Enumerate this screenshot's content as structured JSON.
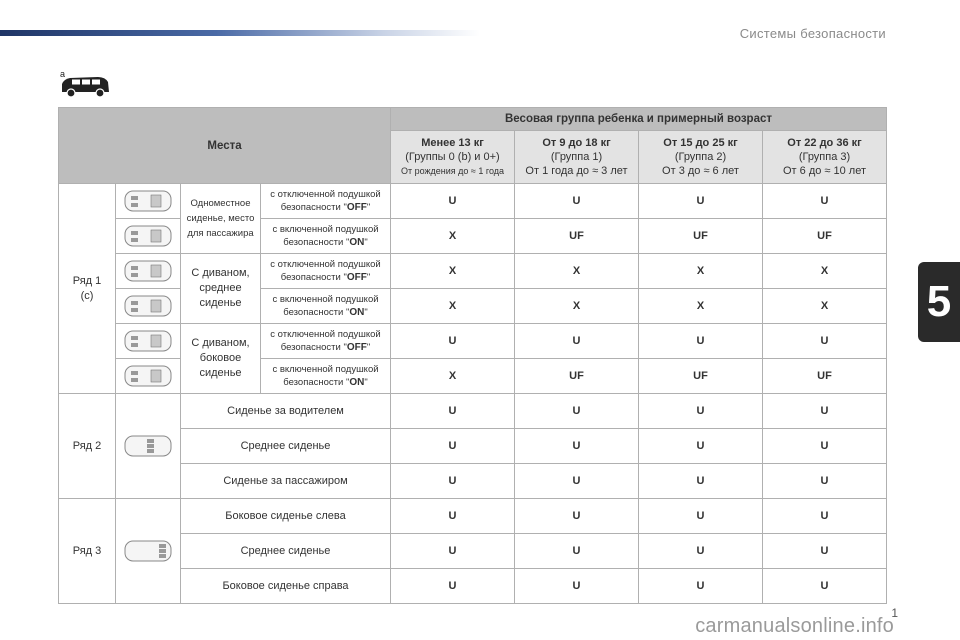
{
  "header": {
    "section_title": "Системы безопасности",
    "chapter_number": "5",
    "page_number": "1",
    "van_label": "a"
  },
  "watermark": "carmanualsonline.info",
  "colors": {
    "header_gray": "#bdbdbd",
    "header_light": "#e3e3e3",
    "accent": "#1f3566"
  },
  "table": {
    "places_header": "Места",
    "weight_header": "Весовая группа ребенка и примерный возраст",
    "groups": [
      {
        "weight": "Менее 13 кг",
        "group": "(Группы 0 (b) и 0+)",
        "age": "От рождения до ≈ 1 года"
      },
      {
        "weight": "От 9 до 18 кг",
        "group": "(Группа 1)",
        "age": "От 1 года до ≈ 3 лет"
      },
      {
        "weight": "От 15 до 25 кг",
        "group": "(Группа 2)",
        "age": "От 3 до ≈ 6 лет"
      },
      {
        "weight": "От 22 до 36 кг",
        "group": "(Группа 3)",
        "age": "От 6 до ≈ 10 лет"
      }
    ],
    "row1": {
      "label": "Ряд 1",
      "note": "(c)",
      "seats": [
        {
          "name": "Одноместное сиденье, место для пассажира",
          "icons": [
            "seat-top-icon",
            "seat-top-icon"
          ],
          "modes": [
            {
              "cond": "с отключенной подушкой безопасности \"",
              "flag": "OFF",
              "end": "\"",
              "values": [
                "U",
                "U",
                "U",
                "U"
              ]
            },
            {
              "cond": "с включенной подушкой безопасности \"",
              "flag": "ON",
              "end": "\"",
              "values": [
                "X",
                "UF",
                "UF",
                "UF"
              ]
            }
          ]
        },
        {
          "name": "С диваном, среднее сиденье",
          "icons": [
            "seat-top-icon"
          ],
          "modes": [
            {
              "cond": "с отключенной подушкой безопасности \"",
              "flag": "OFF",
              "end": "\"",
              "values": [
                "X",
                "X",
                "X",
                "X"
              ]
            },
            {
              "cond": "с включенной подушкой безопасности \"",
              "flag": "ON",
              "end": "\"",
              "values": [
                "X",
                "X",
                "X",
                "X"
              ]
            }
          ]
        },
        {
          "name": "С диваном, боковое сиденье",
          "icons": [
            "seat-top-icon",
            "seat-top-icon"
          ],
          "modes": [
            {
              "cond": "с отключенной подушкой безопасности \"",
              "flag": "OFF",
              "end": "\"",
              "values": [
                "U",
                "U",
                "U",
                "U"
              ]
            },
            {
              "cond": "с включенной подушкой безопасности \"",
              "flag": "ON",
              "end": "\"",
              "values": [
                "X",
                "UF",
                "UF",
                "UF"
              ]
            }
          ]
        }
      ]
    },
    "row2": {
      "label": "Ряд 2",
      "seats": [
        {
          "name": "Сиденье за водителем",
          "values": [
            "U",
            "U",
            "U",
            "U"
          ]
        },
        {
          "name": "Среднее сиденье",
          "values": [
            "U",
            "U",
            "U",
            "U"
          ]
        },
        {
          "name": "Сиденье за пассажиром",
          "values": [
            "U",
            "U",
            "U",
            "U"
          ]
        }
      ]
    },
    "row3": {
      "label": "Ряд 3",
      "seats": [
        {
          "name": "Боковое сиденье слева",
          "values": [
            "U",
            "U",
            "U",
            "U"
          ]
        },
        {
          "name": "Среднее сиденье",
          "values": [
            "U",
            "U",
            "U",
            "U"
          ]
        },
        {
          "name": "Боковое сиденье справа",
          "values": [
            "U",
            "U",
            "U",
            "U"
          ]
        }
      ]
    }
  }
}
